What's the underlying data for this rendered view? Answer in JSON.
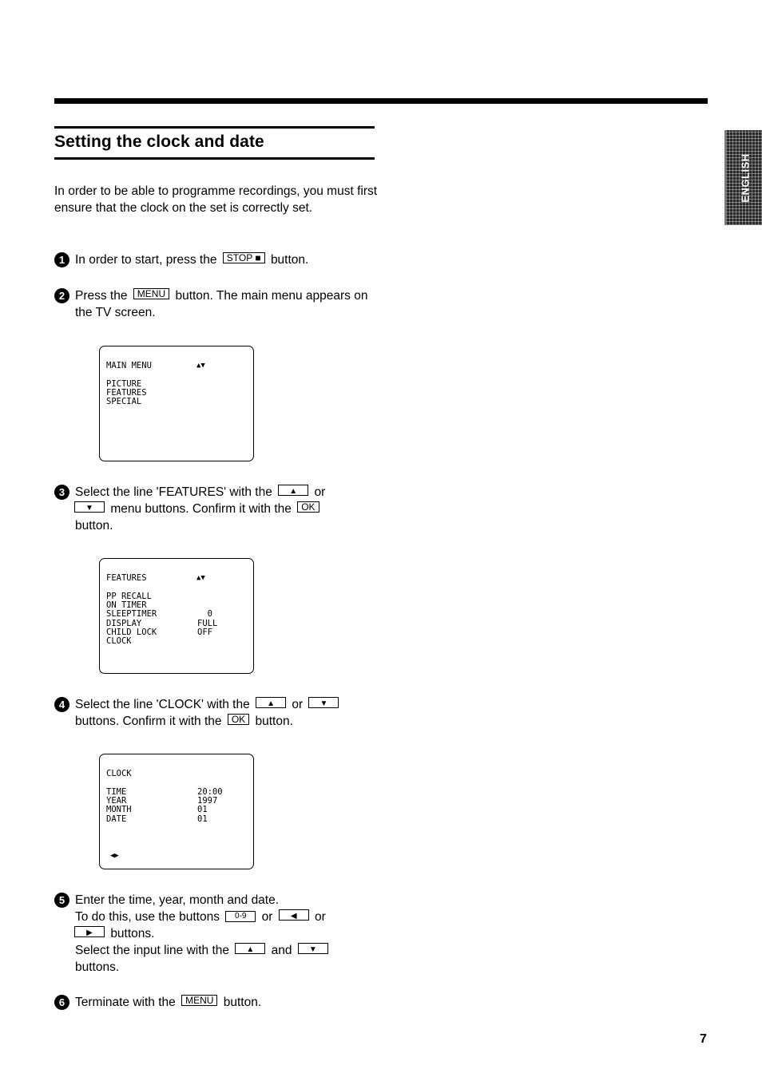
{
  "side_tab": {
    "label": "ENGLISH"
  },
  "title": "Setting the clock and date",
  "intro": "In order to be able to programme recordings, you must first ensure that the clock on the set is correctly set.",
  "keys": {
    "stop": "STOP ■",
    "menu": "MENU",
    "up": "▲",
    "down": "▼",
    "ok": "OK",
    "digits": "0-9",
    "left": "◀",
    "right": "▶"
  },
  "steps": [
    {
      "number": "1",
      "parts": [
        "In order to start, press the",
        "button."
      ]
    },
    {
      "number": "2",
      "parts": [
        "Press the",
        "button. The main menu appears on the TV screen."
      ]
    },
    {
      "number": "3",
      "parts": [
        "Select the line 'FEATURES' with the",
        "or",
        "menu buttons. Confirm it with the",
        "button."
      ]
    },
    {
      "number": "4",
      "parts": [
        "Select the line 'CLOCK' with the",
        "or",
        "buttons. Confirm it with the",
        "button."
      ]
    },
    {
      "number": "5",
      "parts": [
        "Enter the time, year, month and date.",
        "To do this, use the buttons",
        "or",
        "or",
        "buttons.",
        "Select the input line with the",
        "and",
        "buttons."
      ]
    },
    {
      "number": "6",
      "parts": [
        "Terminate with the",
        "button."
      ]
    }
  ],
  "screens": {
    "main_menu": {
      "header": "MAIN MENU",
      "nav_icon": "▲▼",
      "rows": [
        {
          "label": "PICTURE",
          "value": ""
        },
        {
          "label": "FEATURES",
          "value": ""
        },
        {
          "label": "SPECIAL",
          "value": ""
        }
      ]
    },
    "features": {
      "header": "FEATURES",
      "nav_icon": "▲▼",
      "rows": [
        {
          "label": "PP RECALL",
          "value": ""
        },
        {
          "label": "ON TIMER",
          "value": ""
        },
        {
          "label": "SLEEPTIMER",
          "value": "  0"
        },
        {
          "label": "DISPLAY",
          "value": "FULL"
        },
        {
          "label": "CHILD LOCK",
          "value": "OFF"
        },
        {
          "label": "CLOCK",
          "value": ""
        }
      ]
    },
    "clock": {
      "header": "CLOCK",
      "foot_icon": "◀▶",
      "rows": [
        {
          "label": "TIME",
          "value": "20:00"
        },
        {
          "label": "YEAR",
          "value": "1997"
        },
        {
          "label": "MONTH",
          "value": "01"
        },
        {
          "label": "DATE",
          "value": "01"
        }
      ]
    }
  },
  "page_number": "7"
}
